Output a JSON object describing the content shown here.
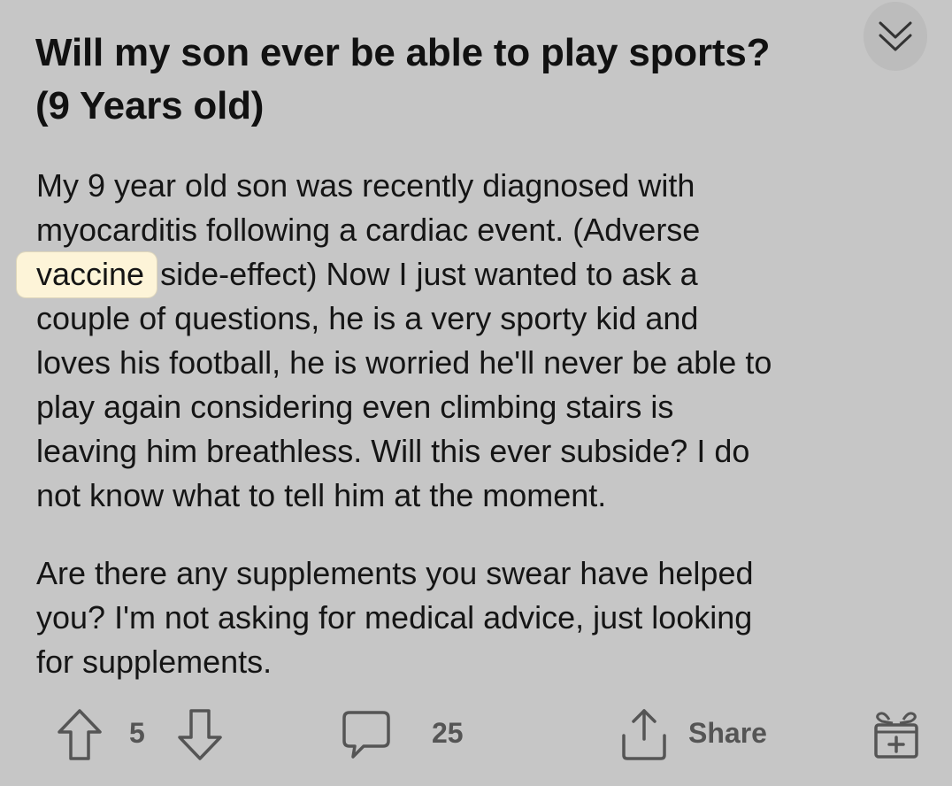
{
  "post": {
    "title_lines": [
      "Will my son ever be able to play sports?",
      "(9 Years old)"
    ],
    "body_paragraph_1": {
      "line1": "My 9 year old son was recently diagnosed with",
      "line2": "myocarditis following a cardiac event. (Adverse",
      "line3_highlight": "vaccine",
      "line3_rest": " side-effect) Now I just wanted to ask a",
      "line4": "couple of questions, he is a very sporty kid and",
      "line5": "loves his football, he is worried he'll never be able to",
      "line6": "play again considering even climbing stairs is",
      "line7": "leaving him breathless. Will this ever subside? I do",
      "line8": "not know what to tell him at the moment."
    },
    "body_paragraph_2": {
      "line1": "Are there any supplements you swear have helped",
      "line2": "you? I'm not asking for medical advice, just looking",
      "line3": "for supplements."
    }
  },
  "actions": {
    "upvote_icon": "arrow-up-icon",
    "vote_count": "5",
    "downvote_icon": "arrow-down-icon",
    "comment_icon": "comment-bubble-icon",
    "comment_count": "25",
    "share_icon": "share-icon",
    "share_label": "Share",
    "award_icon": "gift-icon"
  },
  "colors": {
    "background": "#c6c6c6",
    "highlight": "#fdf4d8",
    "text": "#151515",
    "action_gray": "#555555"
  }
}
